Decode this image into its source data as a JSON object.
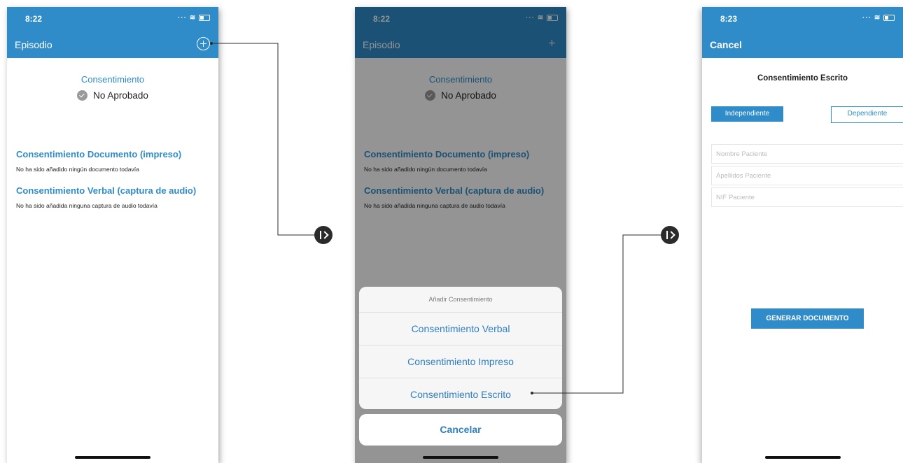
{
  "colors": {
    "accent": "#2f8cc9",
    "dark_header": "#1f5f87",
    "dim_overlay": "rgba(0,0,0,0.42)"
  },
  "screen1": {
    "time": "8:22",
    "nav_title": "Episodio",
    "add_icon": "plus-circle-icon",
    "consent_heading": "Consentimiento",
    "consent_status": "No Aprobado",
    "doc_title": "Consentimiento Documento (impreso)",
    "doc_empty": "No ha sido añadido ningún documento todavía",
    "verbal_title": "Consentimiento Verbal (captura de audio)",
    "verbal_empty": "No ha sido añadida ninguna captura de audio todavía"
  },
  "screen2": {
    "time": "8:22",
    "nav_title": "Episodio",
    "consent_heading": "Consentimiento",
    "consent_status": "No Aprobado",
    "doc_title": "Consentimiento Documento (impreso)",
    "doc_empty": "No ha sido añadido ningún documento todavía",
    "verbal_title": "Consentimiento Verbal (captura de audio)",
    "verbal_empty": "No ha sido añadida ninguna captura de audio todavía",
    "sheet": {
      "title": "Añadir Consentimiento",
      "options": [
        "Consentimiento Verbal",
        "Consentimiento Impreso",
        "Consentimiento Escrito"
      ],
      "cancel": "Cancelar"
    }
  },
  "screen3": {
    "time": "8:23",
    "cancel_label": "Cancel",
    "title": "Consentimiento Escrito",
    "segment_independiente": "Independiente",
    "segment_dependiente": "Dependiente",
    "fields": {
      "nombre_placeholder": "Nombre Paciente",
      "apellidos_placeholder": "Apellidos Paciente",
      "nif_placeholder": "NIF Paciente"
    },
    "generate_button": "GENERAR DOCUMENTO"
  }
}
